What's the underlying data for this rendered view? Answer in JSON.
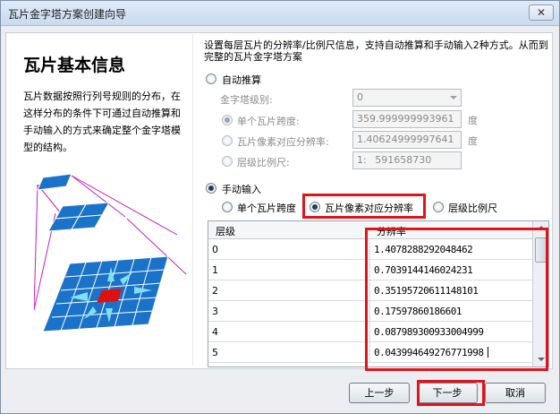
{
  "window": {
    "title": "瓦片金字塔方案创建向导",
    "close_label": "✕"
  },
  "left": {
    "heading": "瓦片基本信息",
    "description": "瓦片数据按照行列号规则的分布，在这样分布的条件下可通过自动推算和手动输入的方式来确定整个金字塔模型的结构。"
  },
  "intro": "设置每层瓦片的分辨率/比例尺信息，支持自动推算和手动输入2种方式。从而到完整的瓦片金字塔方案",
  "auto": {
    "label": "自动推算",
    "level_label": "金字塔级别:",
    "level_value": "0",
    "single_span_label": "单个瓦片跨度:",
    "single_span_value": "359.999999993961",
    "single_span_unit": "度",
    "pixel_res_label": "瓦片像素对应分辨率:",
    "pixel_res_value": "1.40624999997641",
    "pixel_res_unit": "度",
    "scale_label": "层级比例尺:",
    "scale_prefix": "1:",
    "scale_value": "591658730"
  },
  "manual": {
    "label": "手动输入",
    "opt_single_span": "单个瓦片跨度",
    "opt_pixel_res": "瓦片像素对应分辨率",
    "opt_scale": "层级比例尺"
  },
  "table": {
    "headers": [
      "层级",
      "分辨率"
    ],
    "rows": [
      [
        "0",
        "1.4078288292048462"
      ],
      [
        "1",
        "0.7039144146024231"
      ],
      [
        "2",
        "0.35195720611148101"
      ],
      [
        "3",
        "0.17597860186601"
      ],
      [
        "4",
        "0.087989300933004999"
      ],
      [
        "5",
        "0.043994649276771998"
      ]
    ]
  },
  "buttons": {
    "prev": "上一步",
    "next": "下一步",
    "cancel": "取消"
  },
  "colors": {
    "highlight": "#e0141a",
    "tile_blue": "#1a73c8",
    "tile_red": "#e01010"
  }
}
